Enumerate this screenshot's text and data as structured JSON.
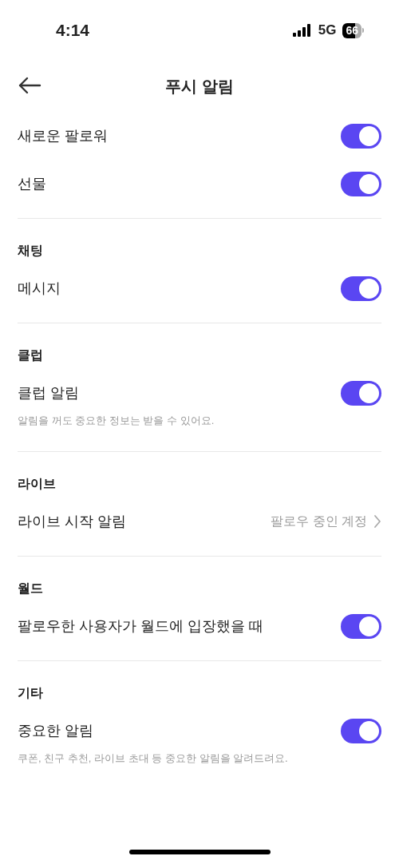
{
  "status_bar": {
    "time": "4:14",
    "network": "5G",
    "battery": "66"
  },
  "header": {
    "title": "푸시 알림"
  },
  "sections": [
    {
      "items": [
        {
          "kind": "toggle",
          "label": "새로운 팔로워",
          "on": true
        },
        {
          "kind": "toggle",
          "label": "선물",
          "on": true
        }
      ]
    },
    {
      "title": "채팅",
      "items": [
        {
          "kind": "toggle",
          "label": "메시지",
          "on": true
        }
      ]
    },
    {
      "title": "클럽",
      "items": [
        {
          "kind": "toggle",
          "label": "클럽 알림",
          "on": true,
          "description": "알림을 꺼도 중요한 정보는 받을 수 있어요."
        }
      ]
    },
    {
      "title": "라이브",
      "items": [
        {
          "kind": "link",
          "label": "라이브 시작 알림",
          "value": "팔로우 중인 계정"
        }
      ]
    },
    {
      "title": "월드",
      "items": [
        {
          "kind": "toggle",
          "label": "팔로우한 사용자가 월드에 입장했을 때",
          "on": true
        }
      ]
    },
    {
      "title": "기타",
      "items": [
        {
          "kind": "toggle",
          "label": "중요한 알림",
          "on": true,
          "description": "쿠폰, 친구 추천, 라이브 초대 등 중요한 알림을 알려드려요."
        }
      ]
    }
  ]
}
